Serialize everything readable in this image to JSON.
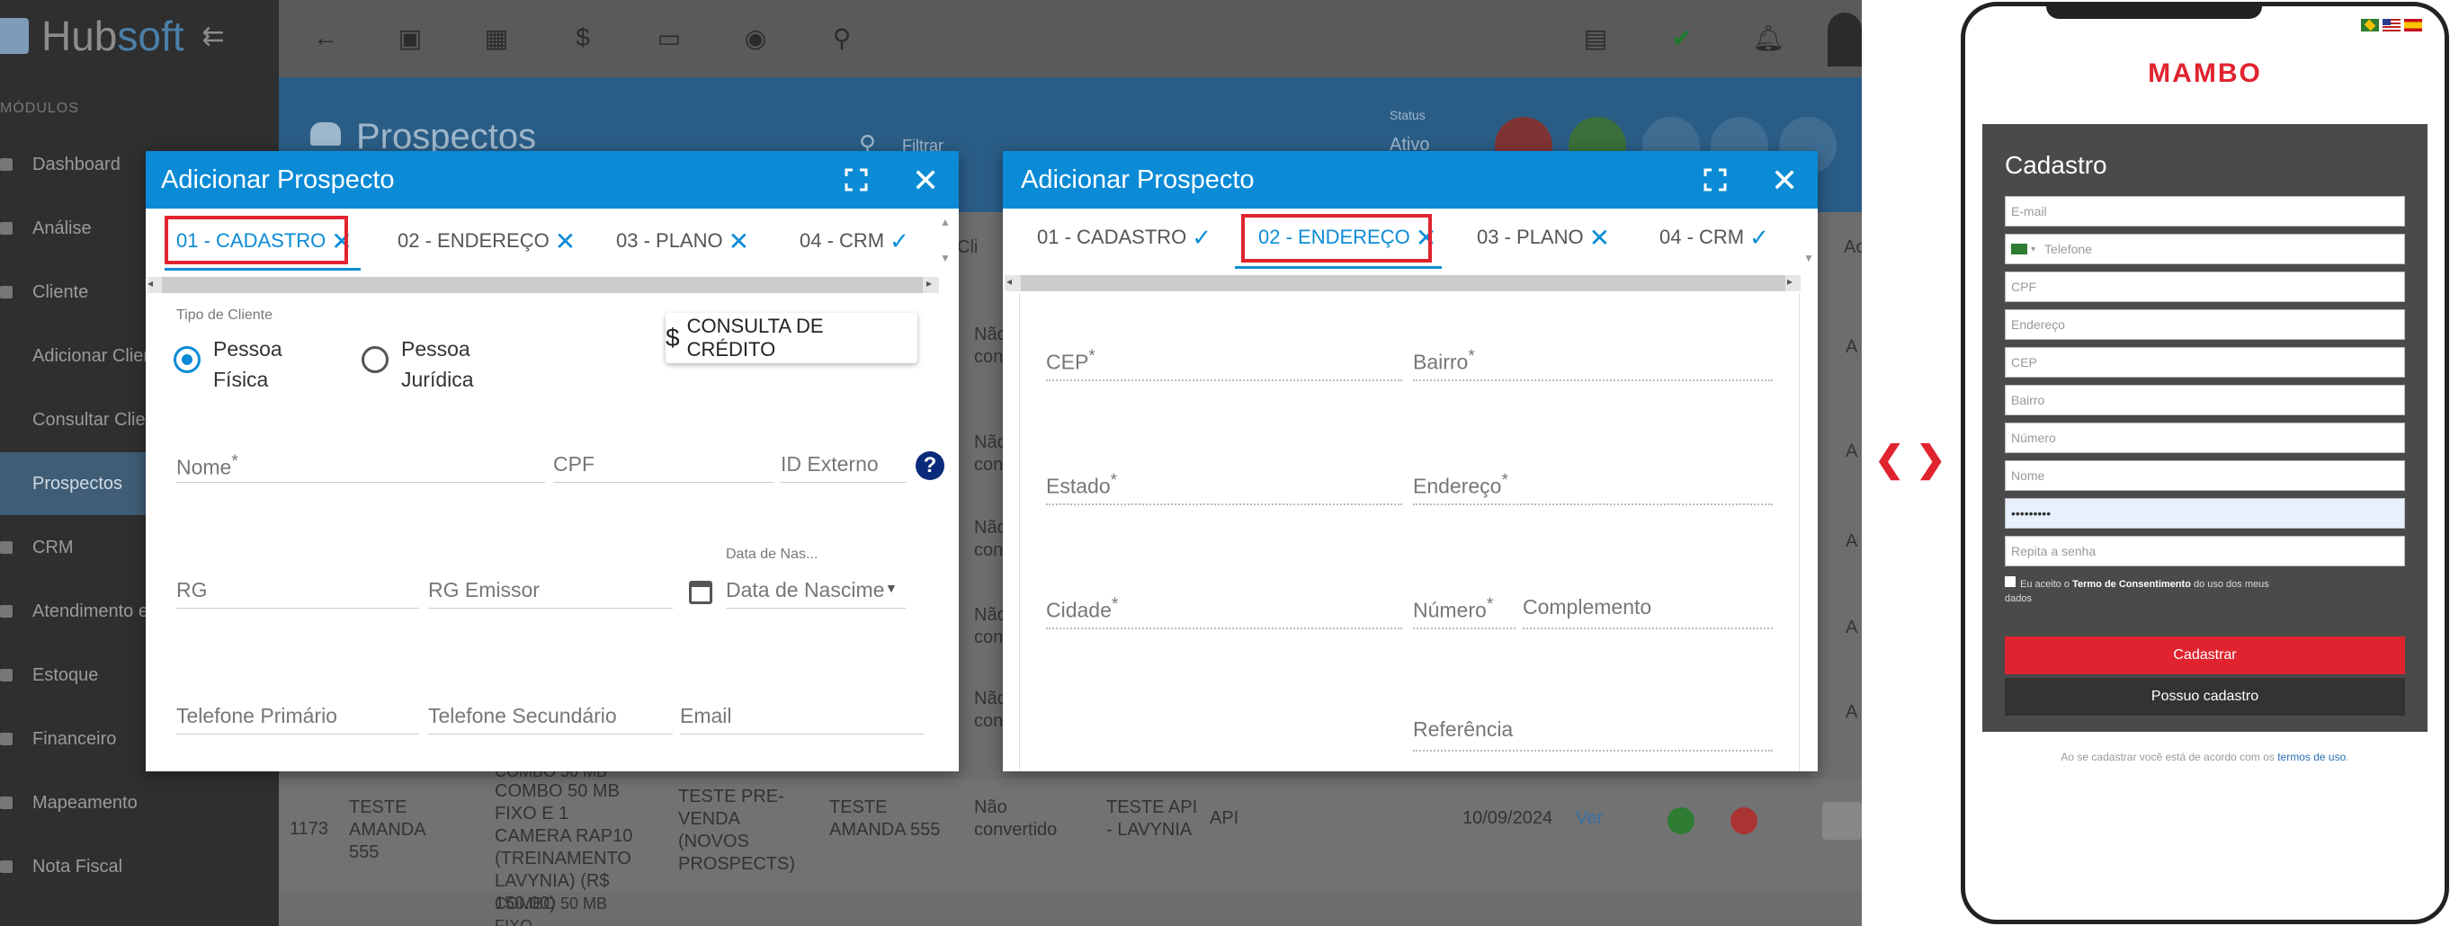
{
  "app": {
    "logo": {
      "hub": "Hub",
      "soft": "soft"
    },
    "modules_label": "MÓDULOS",
    "sidebar": [
      {
        "label": "Dashboard"
      },
      {
        "label": "Análise"
      },
      {
        "label": "Cliente"
      },
      {
        "label": "Adicionar Clien"
      },
      {
        "label": "Consultar Clien"
      },
      {
        "label": "Prospectos"
      },
      {
        "label": "CRM"
      },
      {
        "label": "Atendimento e"
      },
      {
        "label": "Estoque"
      },
      {
        "label": "Financeiro"
      },
      {
        "label": "Mapeamento"
      },
      {
        "label": "Nota Fiscal"
      }
    ],
    "page_title": "Prospectos",
    "filter_placeholder": "Filtrar",
    "status_label": "Status",
    "status_value": "Ativo",
    "bg_row": {
      "id": "1173",
      "name": "TESTE AMANDA 555",
      "plan": "COMBO 50 MB FIXO E 1 CAMERA RAP10 (TREINAMENTO LAVYNIA) (R$ 150.00)",
      "seller": "TESTE PRE-VENDA (NOVOS PROSPECTS)",
      "contact": "TESTE AMANDA 555",
      "status": "Não convertido",
      "origin": "TESTE API - LAVYNIA",
      "channel": "API",
      "date": "10/09/2024",
      "link": "Ver",
      "next_plan": "COMBO 50 MB FIXO",
      "prev_plan": "COMBO 50 MB FIXO"
    },
    "bg_col_header_cli": "Cli",
    "bg_col_header_ac": "Ac",
    "bg_nao": "Não",
    "bg_con": "con",
    "bg_a": "A"
  },
  "modal_left": {
    "title": "Adicionar Prospecto",
    "tabs": [
      {
        "label": "01 - CADASTRO",
        "state": "x"
      },
      {
        "label": "02 - ENDEREÇO",
        "state": "x"
      },
      {
        "label": "03 - PLANO",
        "state": "x"
      },
      {
        "label": "04 - CRM",
        "state": "check"
      }
    ],
    "tipo_label": "Tipo de Cliente",
    "radio_pf": "Pessoa Física",
    "radio_pf_1": "Pessoa",
    "radio_pf_2": "Física",
    "radio_pj_1": "Pessoa",
    "radio_pj_2": "Jurídica",
    "credit_button": "CONSULTA DE CRÉDITO",
    "fields": {
      "nome": "Nome",
      "cpf": "CPF",
      "id_externo": "ID Externo",
      "rg": "RG",
      "rg_emissor": "RG Emissor",
      "data_nasc_small": "Data de Nas...",
      "data_nasc": "Data de Nascimento",
      "tel1": "Telefone Primário",
      "tel2": "Telefone Secundário",
      "email": "Email"
    }
  },
  "modal_right": {
    "title": "Adicionar Prospecto",
    "tabs": [
      {
        "label": "01 - CADASTRO",
        "state": "check"
      },
      {
        "label": "02 - ENDEREÇO",
        "state": "x"
      },
      {
        "label": "03 - PLANO",
        "state": "x"
      },
      {
        "label": "04 - CRM",
        "state": "check"
      }
    ],
    "fields": {
      "cep": "CEP",
      "bairro": "Bairro",
      "estado": "Estado",
      "endereco": "Endereço",
      "cidade": "Cidade",
      "numero": "Número",
      "complemento": "Complemento",
      "referencia": "Referência"
    }
  },
  "mobile": {
    "logo": "MAMBO",
    "form_title": "Cadastro",
    "fields": [
      "E-mail",
      "Telefone",
      "CPF",
      "Endereço",
      "CEP",
      "Bairro",
      "Número",
      "Nome"
    ],
    "password_value": "•••••••••",
    "repeat_password": "Repita a senha",
    "consent_1": "Eu aceito o ",
    "consent_bold": "Termo de Consentimento",
    "consent_2": " do uso dos meus",
    "consent_3": "dados",
    "btn_register": "Cadastrar",
    "btn_have_account": "Possuo cadastro",
    "footer_1": "Ao se cadastrar você está de acordo com os ",
    "footer_link": "termos de uso",
    "footer_2": "."
  },
  "colors": {
    "accent_blue": "#0b8bd6",
    "highlight_red": "#e0242f",
    "brand_red": "#e0242f"
  }
}
